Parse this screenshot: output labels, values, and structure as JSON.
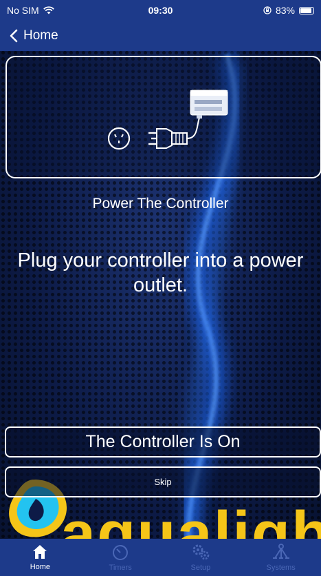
{
  "status_bar": {
    "carrier": "No SIM",
    "time": "09:30",
    "battery": "83%"
  },
  "nav": {
    "back_label": "Home"
  },
  "step": {
    "title": "Power The Controller",
    "description": "Plug your controller into a power outlet."
  },
  "buttons": {
    "primary": "The Controller Is On",
    "skip": "Skip"
  },
  "brand": {
    "wordmark": "aqualight"
  },
  "tabs": [
    {
      "label": "Home",
      "icon": "home-icon",
      "active": true
    },
    {
      "label": "Timers",
      "icon": "timer-icon",
      "active": false
    },
    {
      "label": "Setup",
      "icon": "gears-icon",
      "active": false
    },
    {
      "label": "Systems",
      "icon": "network-icon",
      "active": false
    }
  ],
  "colors": {
    "bar_blue": "#1d3a8a",
    "background": "#0d1b47",
    "logo_yellow": "#f5c518",
    "logo_cyan": "#23c3f0",
    "inactive_tab": "#4a67b6"
  }
}
